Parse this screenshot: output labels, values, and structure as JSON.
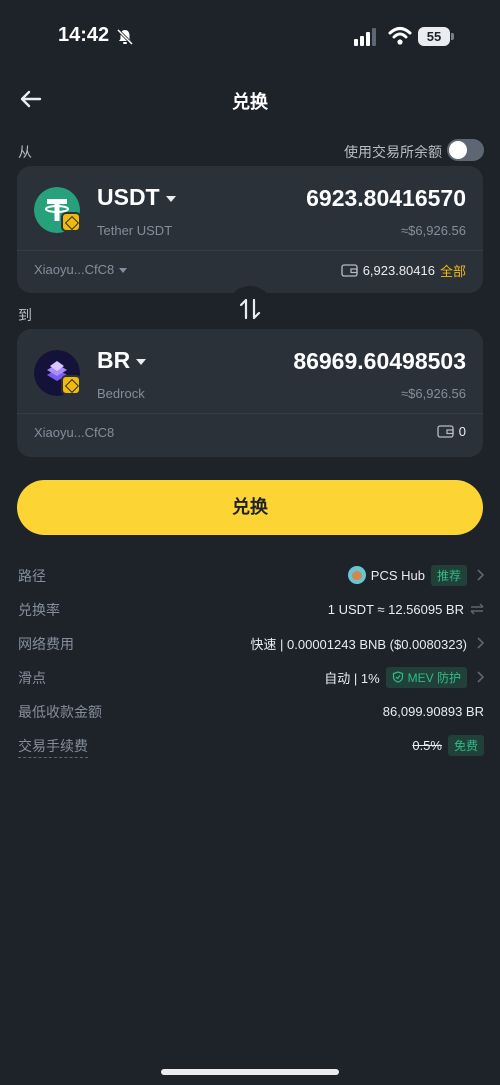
{
  "status": {
    "time": "14:42",
    "battery": "55"
  },
  "header": {
    "title": "兑换"
  },
  "from": {
    "label": "从",
    "exchange_balance_label": "使用交易所余额",
    "symbol": "USDT",
    "name": "Tether USDT",
    "amount": "6923.80416570",
    "usd": "≈$6,926.56",
    "wallet": "Xiaoyu...CfC8",
    "balance": "6,923.80416",
    "max_label": "全部"
  },
  "to": {
    "label": "到",
    "symbol": "BR",
    "name": "Bedrock",
    "amount": "86969.60498503",
    "usd": "≈$6,926.56",
    "wallet": "Xiaoyu...CfC8",
    "balance": "0"
  },
  "swap_button": "兑换",
  "details": {
    "route": {
      "label": "路径",
      "value": "PCS Hub",
      "tag": "推荐"
    },
    "rate": {
      "label": "兑换率",
      "value": "1 USDT ≈ 12.56095 BR"
    },
    "fee": {
      "label": "网络费用",
      "value": "快速 | 0.00001243 BNB ($0.0080323)"
    },
    "slippage": {
      "label": "滑点",
      "value": "自动 | 1%",
      "tag": "MEV 防护"
    },
    "min_receive": {
      "label": "最低收款金额",
      "value": "86,099.90893 BR"
    },
    "trade_fee": {
      "label": "交易手续费",
      "old": "0.5%",
      "tag": "免费"
    }
  },
  "colors": {
    "accent": "#fcd535",
    "background": "#1e2329",
    "card": "#2b3139",
    "positive": "#2ebd85"
  },
  "icons": [
    "bell-off-icon",
    "signal-icon",
    "wifi-icon",
    "battery-icon",
    "back-arrow-icon",
    "usdt-token-icon",
    "bnb-chain-icon",
    "br-token-icon",
    "swap-direction-icon",
    "wallet-icon",
    "pancakeswap-icon",
    "chevron-right-icon",
    "shield-check-icon"
  ]
}
